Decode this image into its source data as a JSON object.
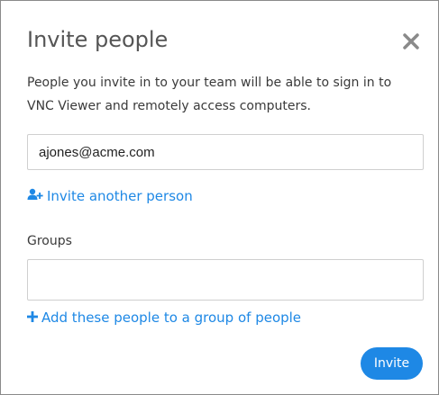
{
  "dialog": {
    "title": "Invite people",
    "close_icon": "close-icon",
    "description_line1": "People you invite in to your team will be able to sign in to",
    "description_line2": "VNC Viewer and remotely access computers.",
    "email_input": {
      "value": "ajones@acme.com",
      "placeholder": ""
    },
    "invite_another": {
      "icon": "add-user-icon",
      "label": "Invite another person"
    },
    "groups": {
      "label": "Groups",
      "value": "",
      "placeholder": ""
    },
    "add_to_group": {
      "icon": "plus-icon",
      "label": "Add these people to a group of people"
    },
    "invite_button": "Invite"
  },
  "colors": {
    "accent": "#1e88e5",
    "title_text": "#555555",
    "body_text": "#3a3a3a",
    "close_icon": "#8a8a8a",
    "input_border": "#cfcfcf"
  }
}
